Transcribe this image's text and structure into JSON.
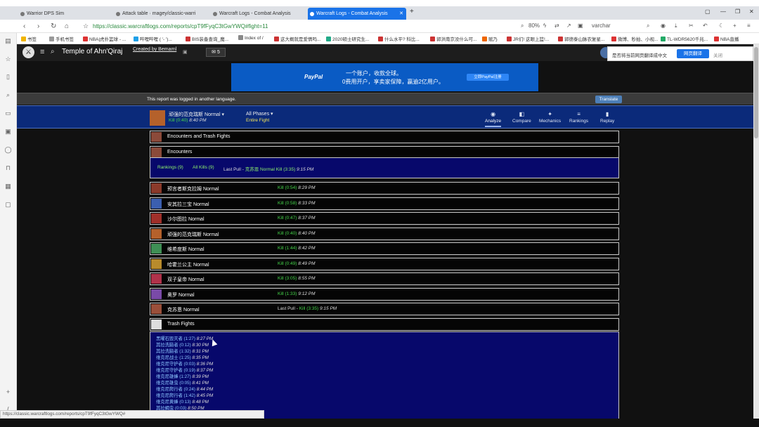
{
  "browser": {
    "tabs": [
      {
        "label": "Warrior DPS Sim"
      },
      {
        "label": "Attack table · magey/classic-warri"
      },
      {
        "label": "Warcraft Logs - Combat Analysis"
      },
      {
        "label": "Warcraft Logs - Combat Analysis"
      }
    ],
    "new_tab": "+",
    "url": "https://classic.warcraftlogs.com/reports/cpT9fFyqC3tGwYWQ#fight=11",
    "zoom": "80%",
    "profile": "varchar",
    "bookmarks": [
      "书签",
      "手机书签",
      "NBA|虎扑篮球 - ...",
      "哔哩哔哩 ( '- ')...",
      "BIS装备查询_魔...",
      "Index of /",
      "这大概就是爱情吗...",
      "2020硕士研究生...",
      "什么水平? 科比...",
      "郭洪南京没什么可...",
      "赋乃",
      "JR们! 这眼上篮!...",
      "郭德泰山脉农复星...",
      "微博、秒拍、小视...",
      "TL-WDR5620千兆...",
      "NBA直播"
    ]
  },
  "site": {
    "zone": "Temple of Ahn'Qiraj",
    "created_by": "Created by Bemarnl",
    "comments_count": "5",
    "ad": {
      "brand": "PayPal",
      "line1": "一个账户，收款全球。",
      "line2": "0费用开户，享卖家保障，赢逾2亿用户。",
      "button": "立即PayPal注册"
    },
    "notice": "This report was logged in another language.",
    "translate_button": "Translate",
    "translate_popup": {
      "text": "是否将当前网页翻译成中文",
      "button": "网页翻译",
      "close": "关闭"
    },
    "fight": {
      "name": "顽强的范克瑞斯 Normal ▾",
      "kill_label": "Kill (0:40)",
      "kill_time": "8:40 PM",
      "phase": "All Phases ▾",
      "phase_sub": "Entire Fight"
    },
    "toolbar": {
      "analyze": "Analyze",
      "compare": "Compare",
      "mechanics": "Mechanics",
      "rankings": "Rankings",
      "replay": "Replay"
    },
    "sections": {
      "encounters_trash": "Encounters and Trash Fights",
      "encounters": "Encounters",
      "trash": "Trash Fights"
    },
    "enc_summary": {
      "rankings": "Rankings (9)",
      "all_kills": "All Kills (9)",
      "last_pull_prefix": "Last Pull - ",
      "last_pull_kill": "克苏恩 Normal Kill (3:35)",
      "last_pull_time": "9:15 PM"
    },
    "bosses": [
      {
        "name": "预言者斯克拉姆 Normal",
        "kill": "Kill (0:54)",
        "time": "8:29 PM",
        "color": "#8b3a2a"
      },
      {
        "name": "安其拉三宝 Normal",
        "kill": "Kill (0:58)",
        "time": "8:33 PM",
        "color": "#3b5fb0"
      },
      {
        "name": "沙尔图拉 Normal",
        "kill": "Kill (0:47)",
        "time": "8:37 PM",
        "color": "#a0302a"
      },
      {
        "name": "顽强的范克瑞斯 Normal",
        "kill": "Kill (0:40)",
        "time": "8:40 PM",
        "color": "#b5612b"
      },
      {
        "name": "维希度斯 Normal",
        "kill": "Kill (1:44)",
        "time": "8:42 PM",
        "color": "#3f8f55"
      },
      {
        "name": "哈霍兰公主 Normal",
        "kill": "Kill (0:49)",
        "time": "8:49 PM",
        "color": "#b88b2c"
      },
      {
        "name": "双子皇帝 Normal",
        "kill": "Kill (3:05)",
        "time": "8:55 PM",
        "color": "#b0324a"
      },
      {
        "name": "奥罗 Normal",
        "kill": "Kill (1:33)",
        "time": "9:12 PM",
        "color": "#7a4aa8"
      },
      {
        "name": "克苏恩 Normal",
        "kill_prefix": "Last Pull - ",
        "kill": "Kill (3:35)",
        "time": "9:15 PM",
        "color": "#9a4f3a"
      }
    ],
    "trash_fights": [
      {
        "name": "黑曜石毁灭者 (1:27)",
        "time": "8:27 PM"
      },
      {
        "name": "其拉洗脑者 (0:12)",
        "time": "8:30 PM"
      },
      {
        "name": "其拉洗脑者 (1:32)",
        "time": "8:31 PM"
      },
      {
        "name": "维克尼战士 (1:25)",
        "time": "8:35 PM"
      },
      {
        "name": "维克尼守护者 (0:03)",
        "time": "8:36 PM"
      },
      {
        "name": "维克尼守护者 (0:19)",
        "time": "8:37 PM"
      },
      {
        "name": "维克尼雄蜂 (1:27)",
        "time": "8:39 PM"
      },
      {
        "name": "维克尼雄虫 (0:05)",
        "time": "8:41 PM"
      },
      {
        "name": "维克尼爬行者 (0:24)",
        "time": "8:44 PM"
      },
      {
        "name": "维克尼爬行者 (1:42)",
        "time": "8:45 PM"
      },
      {
        "name": "维克尼黄蜂 (0:13)",
        "time": "8:48 PM"
      },
      {
        "name": "其拉蝎虫 (0:03)",
        "time": "8:50 PM"
      }
    ],
    "status_url": "https://classic.warcraftlogs.com/reports/cpT9fFyqC3tGwYWQ#"
  }
}
